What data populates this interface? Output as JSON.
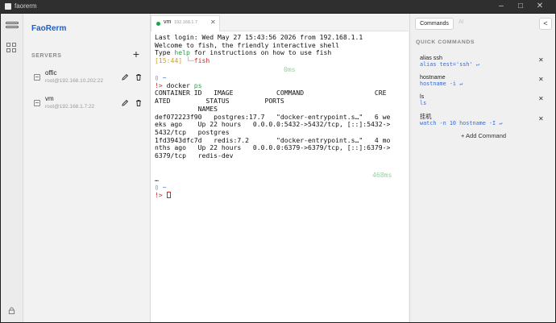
{
  "window": {
    "title": "faorerm"
  },
  "brand": {
    "name": "FaoRerm"
  },
  "sidebar": {
    "section_label": "SERVERS",
    "add_label": "+",
    "servers": [
      {
        "name": "offic",
        "host": "root@192.168.10.202:22"
      },
      {
        "name": "vm",
        "host": "root@192.168.1.7:22"
      }
    ]
  },
  "tabs": [
    {
      "name": "vm",
      "host": "192.168.1.7",
      "close": "✕"
    }
  ],
  "terminal": {
    "login": "Last login: Wed May 27 15:43:56 2026 from 192.168.1.1",
    "welcome": "Welcome to fish, the friendly interactive shell",
    "help_pre": "Type ",
    "help_word": "help",
    "help_post": " for instructions on how to use fish",
    "prompt1_time": "[15:44]",
    "prompt1_arrow": " └─",
    "prompt1_shell": "fish",
    "timing1": "0ms",
    "dir1": "▯ ~",
    "cmd_prompt": "!> ",
    "cmd_docker": "docker ",
    "cmd_ps": "ps",
    "hdr1": "CONTAINER ID   IMAGE           COMMAND                  CRE",
    "hdr2": "ATED         STATUS         PORTS",
    "hdr3": "           NAMES",
    "row1a": "def072223f90   postgres:17.7   \"docker-entrypoint.s…\"   6 we",
    "row1b": "eks ago    Up 22 hours   0.0.0.0:5432->5432/tcp, [::]:5432->",
    "row1c": "5432/tcp   postgres",
    "row2a": "1fd3943dfc7d   redis:7.2       \"docker-entrypoint.s…\"   4 mo",
    "row2b": "nths ago   Up 22 hours   0.0.0.0:6379->6379/tcp, [::]:6379->",
    "row2c": "6379/tcp   redis-dev",
    "ellipsis": "…",
    "timing2": "468ms",
    "dir2": "▯ ~",
    "prompt2": "!> "
  },
  "right_panel": {
    "tab_active": "Commands",
    "tab_inactive": "AI",
    "collapse": "<",
    "section_label": "QUICK COMMANDS",
    "commands": [
      {
        "name": "alias ssh",
        "cmd": "alias test='ssh'  ↵",
        "remove": "✕"
      },
      {
        "name": "hostname",
        "cmd": "hostname -i  ↵",
        "remove": "✕"
      },
      {
        "name": "ls",
        "cmd": "ls",
        "remove": "✕"
      },
      {
        "name": "挂机",
        "cmd": "watch -n 10 hostname -I  ↵",
        "remove": "✕"
      }
    ],
    "add_label": "+ Add Command"
  }
}
